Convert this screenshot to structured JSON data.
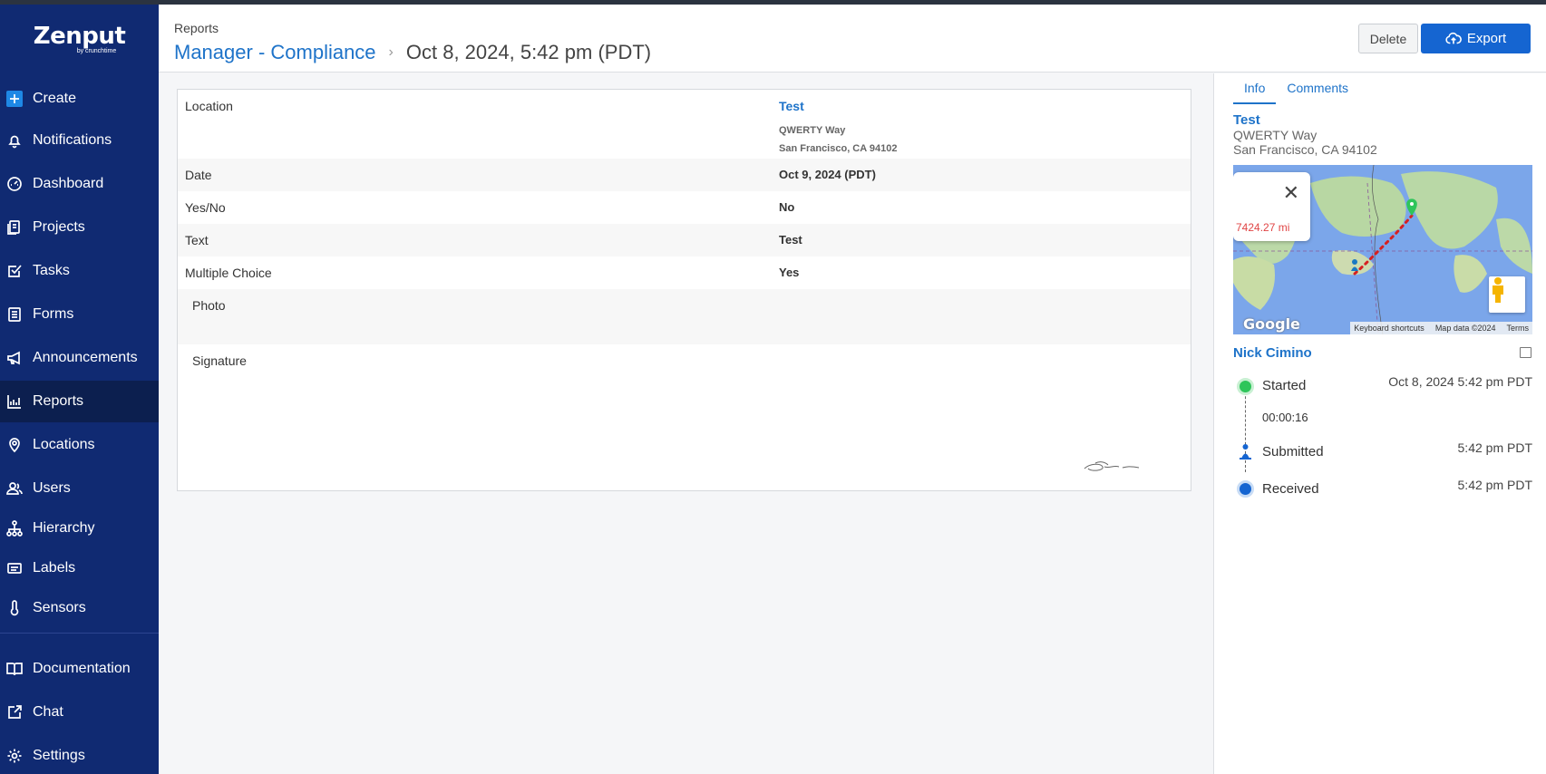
{
  "app": {
    "logo_text": "Zenput",
    "logo_subtext": "by crunchtime"
  },
  "sidebar": {
    "items": [
      {
        "label": "Create",
        "icon": "plus-icon"
      },
      {
        "label": "Notifications",
        "icon": "bell-icon"
      },
      {
        "label": "Dashboard",
        "icon": "gauge-icon"
      },
      {
        "label": "Projects",
        "icon": "projects-icon"
      },
      {
        "label": "Tasks",
        "icon": "checkbox-icon"
      },
      {
        "label": "Forms",
        "icon": "form-icon"
      },
      {
        "label": "Announcements",
        "icon": "megaphone-icon"
      },
      {
        "label": "Reports",
        "icon": "chart-icon",
        "active": true
      },
      {
        "label": "Locations",
        "icon": "pin-icon"
      },
      {
        "label": "Users",
        "icon": "users-icon"
      },
      {
        "label": "Hierarchy",
        "icon": "hierarchy-icon"
      },
      {
        "label": "Labels",
        "icon": "label-icon"
      },
      {
        "label": "Sensors",
        "icon": "thermometer-icon"
      },
      {
        "label": "Documentation",
        "icon": "book-icon"
      },
      {
        "label": "Chat",
        "icon": "chat-icon"
      },
      {
        "label": "Settings",
        "icon": "gear-icon"
      }
    ]
  },
  "header": {
    "breadcrumb": "Reports",
    "title": "Manager - Compliance",
    "separator": "›",
    "date": "Oct 8, 2024, 5:42 pm (PDT)",
    "delete_label": "Delete",
    "export_label": "Export"
  },
  "report": {
    "location_label": "Location",
    "location_name": "Test",
    "location_street": "QWERTY Way",
    "location_city": "San Francisco, CA  94102",
    "rows": [
      {
        "label": "Date",
        "value": "Oct 9, 2024 (PDT)"
      },
      {
        "label": "Yes/No",
        "value": "No"
      },
      {
        "label": "Text",
        "value": "Test"
      },
      {
        "label": "Multiple Choice",
        "value": "Yes"
      }
    ],
    "photo_label": "Photo",
    "signature_label": "Signature"
  },
  "panel": {
    "tabs": [
      "Info",
      "Comments"
    ],
    "active_tab": "Info",
    "location_name": "Test",
    "location_street": "QWERTY Way",
    "location_city": "San Francisco, CA 94102",
    "map": {
      "distance": "7424.27 mi",
      "google_label": "Google",
      "keyboard_shortcuts": "Keyboard shortcuts",
      "map_data": "Map data ©2024",
      "terms": "Terms"
    },
    "user_name": "Nick Cimino",
    "timeline": {
      "started_label": "Started",
      "started_time": "Oct 8, 2024 5:42 pm PDT",
      "duration": "00:00:16",
      "submitted_label": "Submitted",
      "submitted_time": "5:42 pm PDT",
      "received_label": "Received",
      "received_time": "5:42 pm PDT"
    }
  },
  "colors": {
    "sidebar_bg": "#102a72",
    "sidebar_active": "#0c1f4f",
    "accent": "#1e73c9",
    "export_button": "#1565d1",
    "started_green": "#2ec55a",
    "received_blue": "#1565d1",
    "distance_red": "#e04545"
  }
}
